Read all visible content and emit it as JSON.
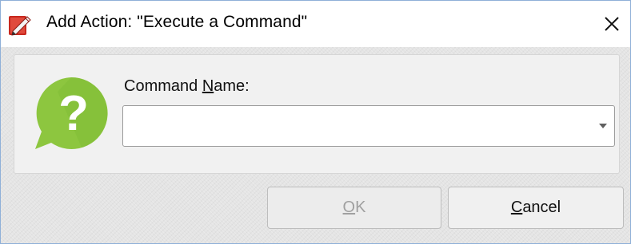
{
  "window": {
    "title": "Add Action: \"Execute a Command\"",
    "close_glyph": "✕",
    "app_icon": "pdf-editor-icon"
  },
  "form": {
    "help_icon": "question-bubble-icon",
    "label_prefix": "Command ",
    "label_mnemonic": "N",
    "label_suffix": "ame:",
    "combo_value": "",
    "combo_arrow_icon": "dropdown-arrow-icon"
  },
  "buttons": {
    "ok_mnemonic": "O",
    "ok_rest": "K",
    "ok_enabled": false,
    "cancel_mnemonic": "C",
    "cancel_rest": "ancel"
  },
  "colors": {
    "help_green": "#8dc63f",
    "app_icon_red": "#c8281e",
    "disabled_text": "#a0a0a0"
  }
}
